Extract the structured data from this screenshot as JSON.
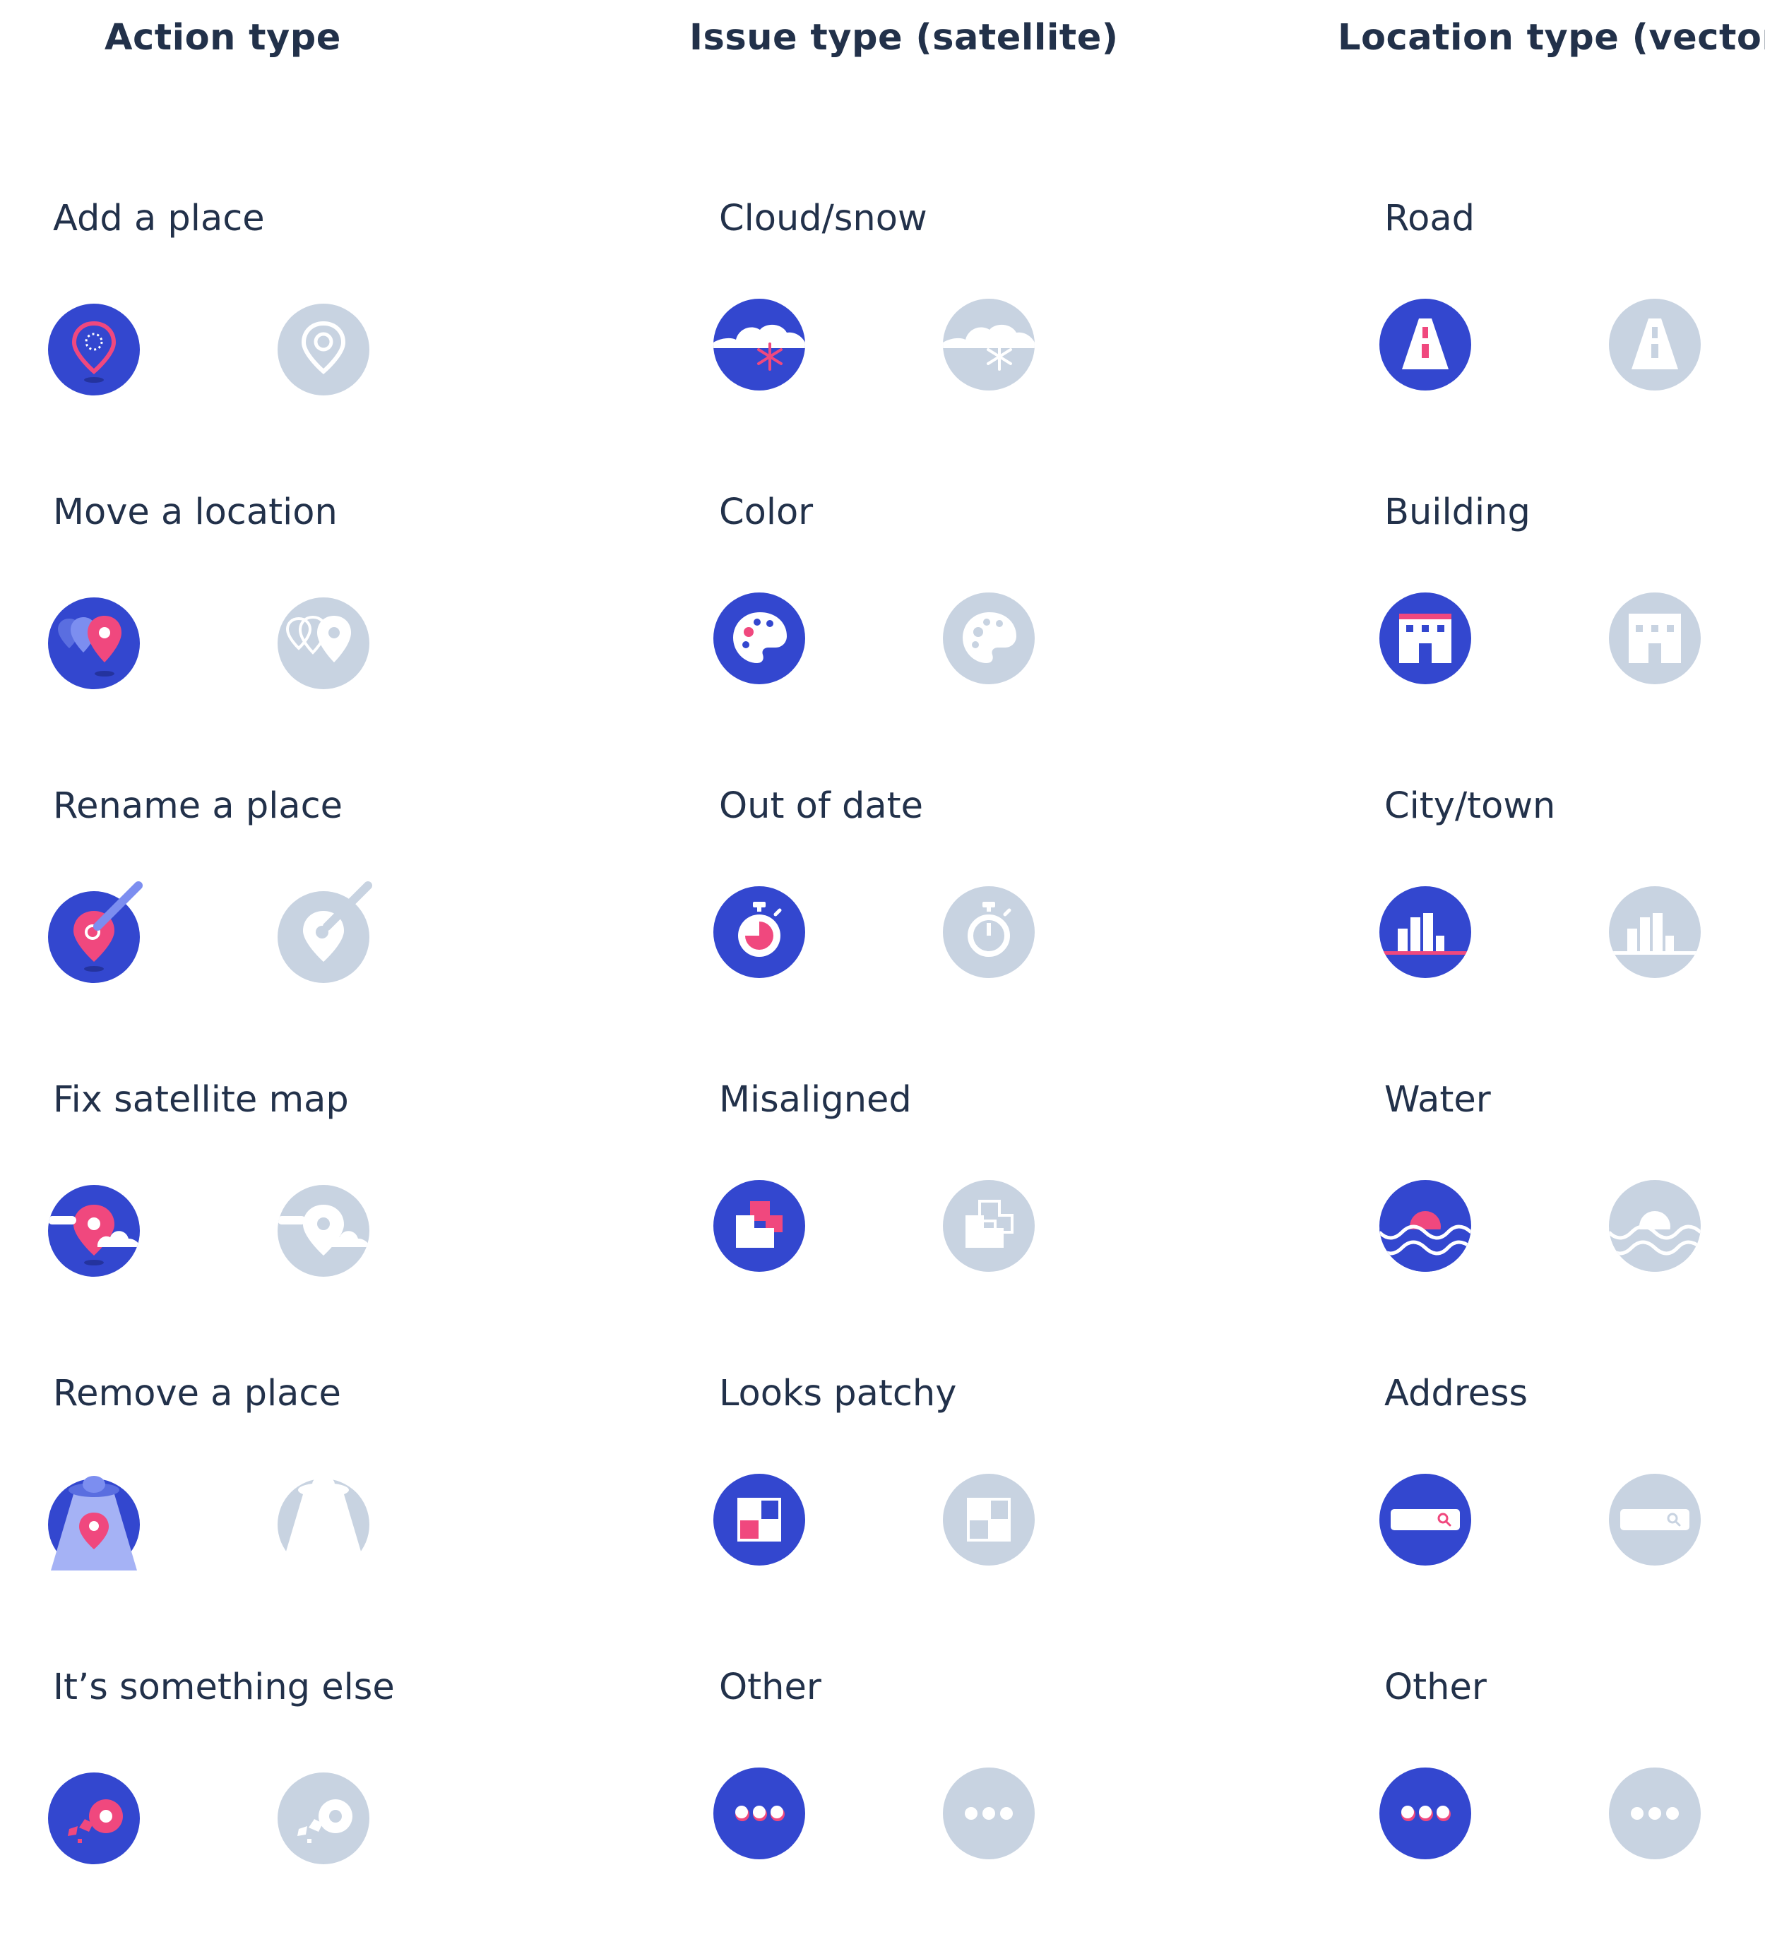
{
  "colors": {
    "active_bg": "#3347cf",
    "inactive_bg": "#c8d3e1",
    "accent": "#f0487e",
    "text": "#22314a"
  },
  "columns": [
    {
      "heading": "Action type",
      "items": [
        {
          "label": "Add a place",
          "icon": "map-pin-icon"
        },
        {
          "label": "Move a location",
          "icon": "move-pins-icon"
        },
        {
          "label": "Rename a place",
          "icon": "pin-pencil-icon"
        },
        {
          "label": "Fix satellite map",
          "icon": "pin-clouds-icon"
        },
        {
          "label": "Remove a place",
          "icon": "pin-ufo-icon"
        },
        {
          "label": "It’s something else",
          "icon": "broken-pin-icon"
        }
      ]
    },
    {
      "heading": "Issue type (satellite)",
      "items": [
        {
          "label": "Cloud/snow",
          "icon": "cloud-snow-icon"
        },
        {
          "label": "Color",
          "icon": "palette-icon"
        },
        {
          "label": "Out of date",
          "icon": "stopwatch-icon"
        },
        {
          "label": "Misaligned",
          "icon": "misaligned-squares-icon"
        },
        {
          "label": "Looks patchy",
          "icon": "patchy-grid-icon"
        },
        {
          "label": "Other",
          "icon": "more-dots-icon"
        }
      ]
    },
    {
      "heading": "Location type (vector)",
      "items": [
        {
          "label": "Road",
          "icon": "road-icon"
        },
        {
          "label": "Building",
          "icon": "building-icon"
        },
        {
          "label": "City/town",
          "icon": "city-icon"
        },
        {
          "label": "Water",
          "icon": "water-waves-icon"
        },
        {
          "label": "Address",
          "icon": "address-search-icon"
        },
        {
          "label": "Other",
          "icon": "more-dots-icon"
        }
      ]
    }
  ]
}
